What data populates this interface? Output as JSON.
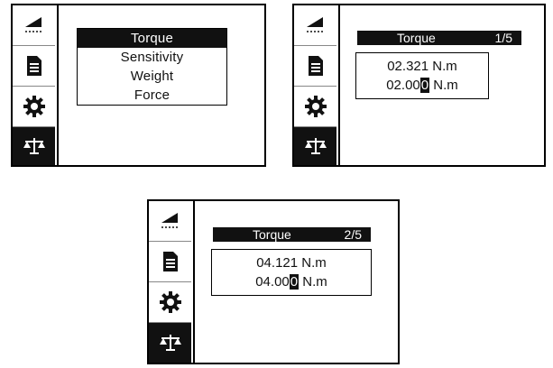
{
  "panel1": {
    "menu": [
      "Torque",
      "Sensitivity",
      "Weight",
      "Force"
    ],
    "selected_index": 0
  },
  "panel2": {
    "title": "Torque",
    "page": "1/5",
    "value1": "02.321",
    "unit1": "N.m",
    "value2_prefix": "02.00",
    "value2_cursor": "0",
    "unit2": "N.m"
  },
  "panel3": {
    "title": "Torque",
    "page": "2/5",
    "value1": "04.121",
    "unit1": "N.m",
    "value2_prefix": "04.00",
    "value2_cursor": "0",
    "unit2": "N.m"
  },
  "sidebar_icons": [
    "angle-ruler-icon",
    "document-icon",
    "gear-icon",
    "balance-scale-icon"
  ],
  "colors": {
    "foreground": "#111111",
    "background": "#ffffff"
  }
}
